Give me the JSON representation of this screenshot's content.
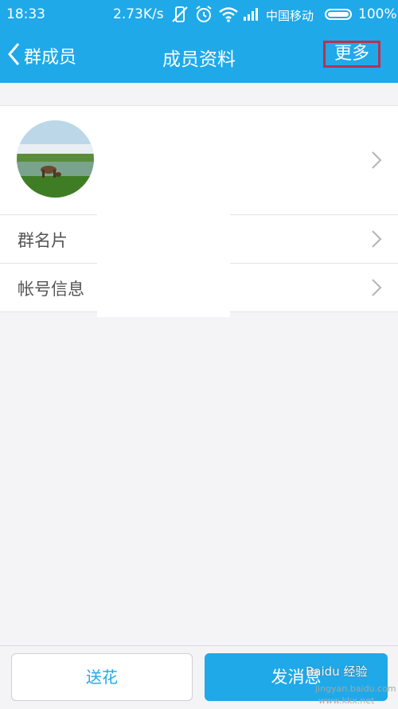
{
  "status_bar": {
    "time": "18:33",
    "speed": "2.73K/s",
    "carrier": "中国移动",
    "battery": "100%",
    "battery_level": 1.0
  },
  "header": {
    "back_label": "群成员",
    "title": "成员资料",
    "more_label": "更多"
  },
  "list": {
    "items": [
      {
        "label": "群名片"
      },
      {
        "label": "帐号信息"
      }
    ]
  },
  "footer": {
    "flower_label": "送花",
    "message_label": "发消息"
  },
  "watermark": {
    "brand": "Baidu 经验",
    "url": "jingyan.baidu.com",
    "site": "www.kkx.net"
  },
  "colors": {
    "accent": "#1fa9e9",
    "highlight_border": "#b8324f"
  }
}
